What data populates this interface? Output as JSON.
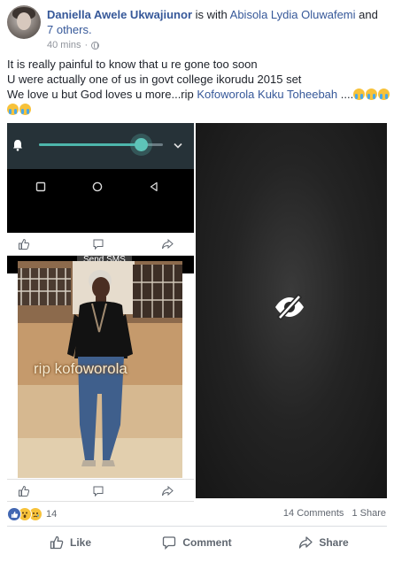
{
  "post": {
    "author": "Daniella Awele Ukwajiunor",
    "with_text": "is with",
    "tagged_person": "Abisola Lydia Oluwafemi",
    "and_text": "and",
    "others": "7 others.",
    "time": "40 mins",
    "privacy_icon": "globe-icon",
    "text_line1": "It is really painful to know that u re gone too soon",
    "text_line2": "U were actually one of us in govt college ikorudu 2015 set",
    "text_line3_prefix": "We love u but God loves u more...rip",
    "text_line3_tag": "Kofoworola Kuku Toheebah",
    "text_line3_suffix": "....",
    "emoji": "crying-face"
  },
  "photo_left": {
    "notification_shade": {
      "icons": [
        "bell-icon",
        "chevron-down-icon"
      ],
      "volume_level": 0.82,
      "accent_color": "#4db6ac"
    },
    "nav_icons": [
      "square-icon",
      "circle-icon",
      "back-triangle-icon"
    ],
    "tooltip": "Send SMS",
    "action_icons": [
      "thumbs-up-icon",
      "comment-icon",
      "share-icon"
    ],
    "overlay_caption": "rip kofoworola"
  },
  "photo_right": {
    "icon": "eye-slash-icon"
  },
  "reactions": {
    "icons": [
      "like-reaction-icon",
      "wow-reaction-icon",
      "sad-reaction-icon"
    ],
    "count": "14",
    "comments": "14 Comments",
    "shares": "1 Share"
  },
  "actions": {
    "like": "Like",
    "comment": "Comment",
    "share": "Share"
  },
  "colors": {
    "link": "#365899",
    "text": "#1d2129",
    "muted": "#90949c",
    "like_blue": "#4267b2"
  }
}
